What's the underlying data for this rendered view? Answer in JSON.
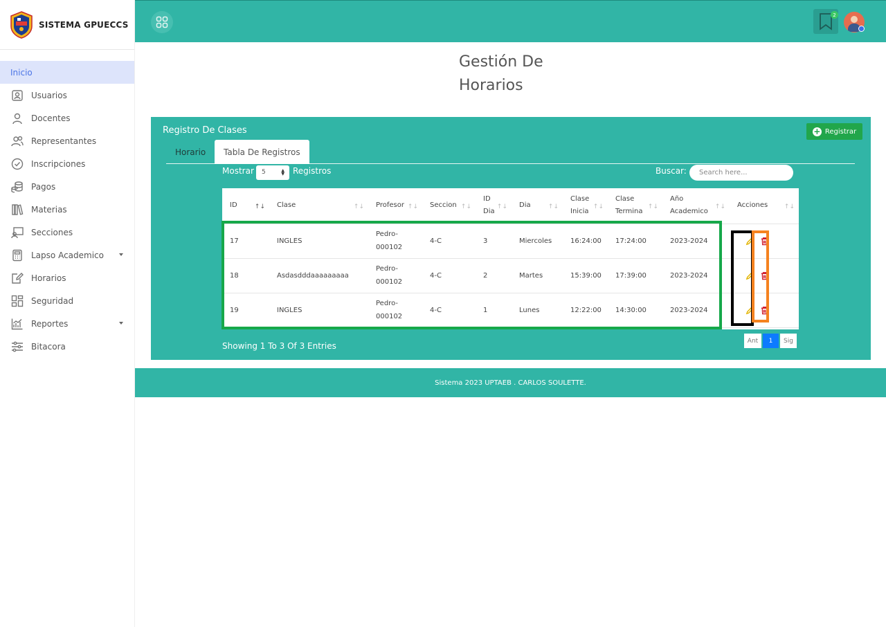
{
  "brand": {
    "name": "SISTEMA GPUECCS"
  },
  "sidebar": {
    "items": [
      {
        "label": "Inicio",
        "icon": "home-icon",
        "active": true
      },
      {
        "label": "Usuarios",
        "icon": "user-badge-icon"
      },
      {
        "label": "Docentes",
        "icon": "person-icon"
      },
      {
        "label": "Representantes",
        "icon": "users-icon"
      },
      {
        "label": "Inscripciones",
        "icon": "check-circle-icon"
      },
      {
        "label": "Pagos",
        "icon": "coins-icon"
      },
      {
        "label": "Materias",
        "icon": "books-icon"
      },
      {
        "label": "Secciones",
        "icon": "presentation-icon"
      },
      {
        "label": "Lapso Academico",
        "icon": "calculator-icon",
        "has_caret": true
      },
      {
        "label": "Horarios",
        "icon": "edit-doc-icon"
      },
      {
        "label": "Seguridad",
        "icon": "layout-icon"
      },
      {
        "label": "Reportes",
        "icon": "chart-icon",
        "has_caret": true
      },
      {
        "label": "Bitacora",
        "icon": "sliders-icon"
      }
    ]
  },
  "topbar": {
    "notification_count": "2",
    "accent": "#31b5a6"
  },
  "page": {
    "title_line1": "Gestión De",
    "title_line2": "Horarios"
  },
  "card": {
    "title": "Registro De Clases",
    "register_button": "Registrar",
    "tabs": [
      {
        "label": "Horario"
      },
      {
        "label": "Tabla De Registros"
      }
    ],
    "show_label": "Mostrar",
    "page_size": "5",
    "records_label": "Registros",
    "search_label": "Buscar:",
    "search_placeholder": "Search here..."
  },
  "table": {
    "headers": [
      {
        "line1": "ID",
        "line2": "",
        "sort": "↑↓"
      },
      {
        "line1": "Clase",
        "line2": "",
        "sort": "↑↓"
      },
      {
        "line1": "Profesor",
        "line2": "",
        "sort": "↑↓"
      },
      {
        "line1": "Seccion",
        "line2": "",
        "sort": "↑↓"
      },
      {
        "line1": "ID",
        "line2": "Dia",
        "sort": "↑↓"
      },
      {
        "line1": "Dia",
        "line2": "",
        "sort": "↑↓"
      },
      {
        "line1": "Clase",
        "line2": "Inicia",
        "sort": "↑↓"
      },
      {
        "line1": "Clase",
        "line2": "Termina",
        "sort": "↑↓"
      },
      {
        "line1": "Año",
        "line2": "Academico",
        "sort": "↑↓"
      },
      {
        "line1": "Acciones",
        "line2": "",
        "sort": "↑↓"
      }
    ],
    "rows": [
      {
        "id": "17",
        "clase": "INGLES",
        "prof1": "Pedro-",
        "prof2": "000102",
        "seccion": "4-C",
        "id_dia": "3",
        "dia": "Miercoles",
        "inicia": "16:24:00",
        "termina": "17:24:00",
        "anio": "2023-2024"
      },
      {
        "id": "18",
        "clase": "Asdasdddaaaaaaaaa",
        "prof1": "Pedro-",
        "prof2": "000102",
        "seccion": "4-C",
        "id_dia": "2",
        "dia": "Martes",
        "inicia": "15:39:00",
        "termina": "17:39:00",
        "anio": "2023-2024"
      },
      {
        "id": "19",
        "clase": "INGLES",
        "prof1": "Pedro-",
        "prof2": "000102",
        "seccion": "4-C",
        "id_dia": "1",
        "dia": "Lunes",
        "inicia": "12:22:00",
        "termina": "14:30:00",
        "anio": "2023-2024"
      }
    ],
    "showing_text": "Showing 1 To 3 Of 3 Entries"
  },
  "pager": {
    "prev": "Ant",
    "current": "1",
    "next": "Sig"
  },
  "footer": {
    "text": "Sistema 2023 UPTAEB . CARLOS SOULETTE."
  }
}
